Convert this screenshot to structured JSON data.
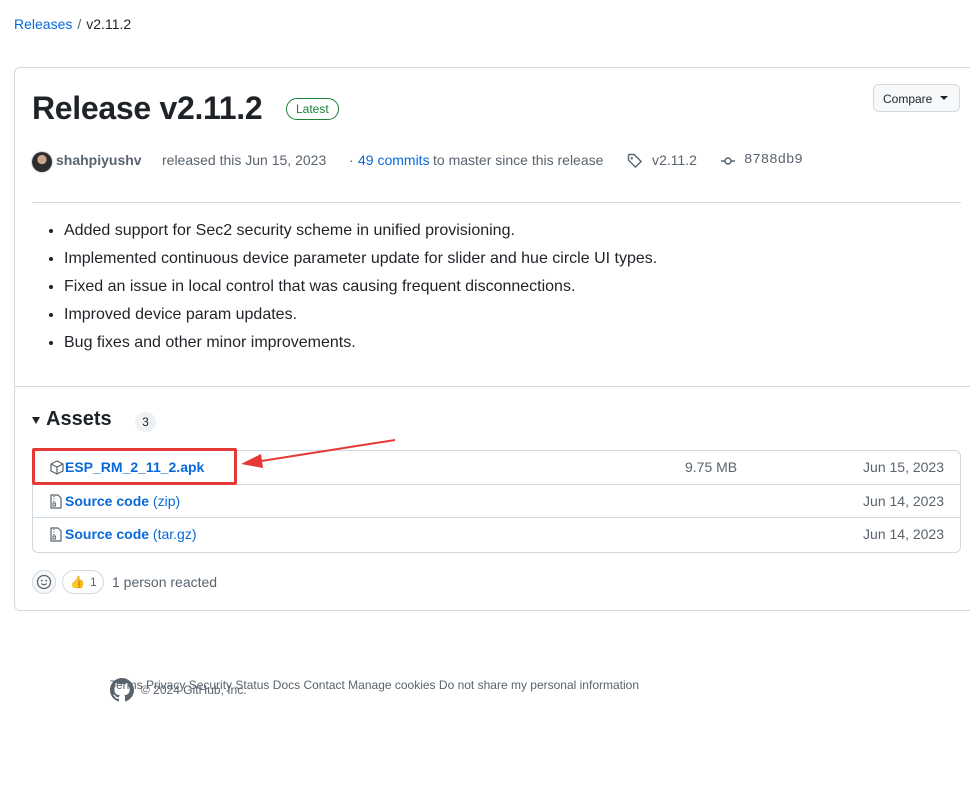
{
  "breadcrumb": {
    "releases": "Releases",
    "separator": "/",
    "current": "v2.11.2"
  },
  "release": {
    "title": "Release v2.11.2",
    "latest_badge": "Latest",
    "compare_label": "Compare",
    "author": "shahpiyushv",
    "released_text": "released this Jun 15, 2023",
    "dot": "·",
    "commits_link": "49 commits",
    "commits_suffix": "to master since this release",
    "tag": "v2.11.2",
    "commit_sha": "8788db9",
    "notes": [
      "Added support for Sec2 security scheme in unified provisioning.",
      "Implemented continuous device parameter update for slider and hue circle UI types.",
      "Fixed an issue in local control that was causing frequent disconnections.",
      "Improved device param updates.",
      "Bug fixes and other minor improvements."
    ]
  },
  "assets": {
    "label": "Assets",
    "count": "3",
    "items": [
      {
        "name": "ESP_RM_2_11_2.apk",
        "format": "",
        "size": "9.75 MB",
        "date": "Jun 15, 2023",
        "icon": "package-icon"
      },
      {
        "name": "Source code",
        "format": "(zip)",
        "size": "",
        "date": "Jun 14, 2023",
        "icon": "file-zip-icon"
      },
      {
        "name": "Source code",
        "format": "(tar.gz)",
        "size": "",
        "date": "Jun 14, 2023",
        "icon": "file-zip-icon"
      }
    ]
  },
  "reactions": {
    "thumbs_up_count": "1",
    "summary": "1 person reacted"
  },
  "footer": {
    "copyright": "© 2024 GitHub, Inc.",
    "links": [
      "Terms",
      "Privacy",
      "Security",
      "Status",
      "Docs",
      "Contact",
      "Manage cookies",
      "Do not share my personal information"
    ]
  },
  "colors": {
    "link": "#0969da",
    "latest": "#1a7f37",
    "annotation": "#e53935",
    "muted": "#59636e",
    "border": "#d1d9e0"
  }
}
